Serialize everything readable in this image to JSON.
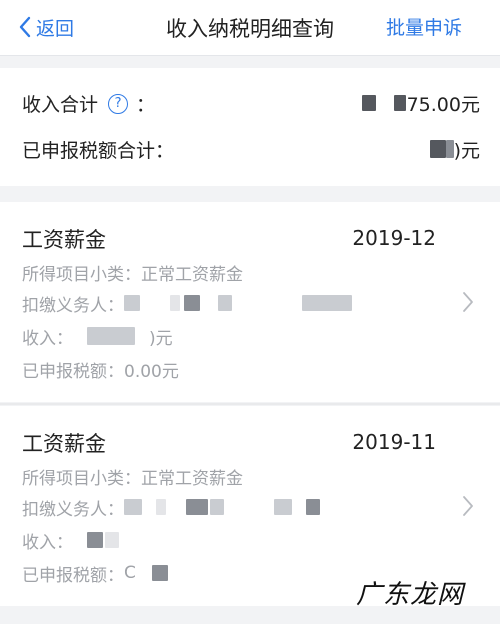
{
  "nav": {
    "back_label": "返回",
    "title": "收入纳税明细查询",
    "action_label": "批量申诉"
  },
  "summary": {
    "income_label": "收入合计",
    "income_colon": "：",
    "income_value_tail": "75.00元",
    "tax_label": "已申报税额合计：",
    "tax_value_tail": ")元"
  },
  "records": [
    {
      "category": "工资薪金",
      "period": "2019-12",
      "subtype": "所得项目小类：正常工资薪金",
      "withholder_label": "扣缴义务人：",
      "income_label": "收入：",
      "income_tail": ")元",
      "tax": "已申报税额：0.00元"
    },
    {
      "category": "工资薪金",
      "period": "2019-11",
      "subtype": "所得项目小类：正常工资薪金",
      "withholder_label": "扣缴义务人：",
      "income_label": "收入：",
      "tax_label": "已申报税额：",
      "tax_tail": "C"
    }
  ],
  "watermark": "广东龙网",
  "icons": {
    "back": "chevron-left-icon",
    "help": "question-circle-icon",
    "row": "chevron-right-icon"
  },
  "colors": {
    "accent": "#2f7ae5",
    "muted": "#a0a3a8",
    "background": "#f2f3f5"
  }
}
